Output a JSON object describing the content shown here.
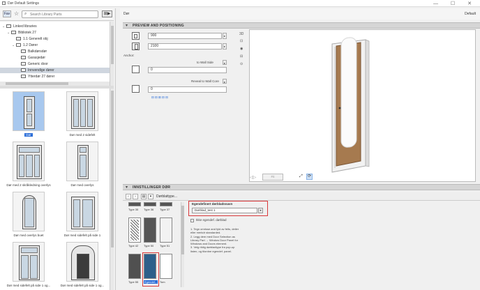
{
  "window": {
    "title": "Dør Default Settings",
    "controls": "— ☐ ✕"
  },
  "left_toolbar": {
    "favorites_btn": "Fav",
    "star": "☆",
    "search_placeholder": "Search Library Parts",
    "collapse_btn": "⊞▶"
  },
  "tree": [
    {
      "label": "Linked libraries",
      "indent": 0,
      "expander": "⌄",
      "selected": false
    },
    {
      "label": "Bibliotek 27",
      "indent": 1,
      "expander": "⌄",
      "selected": false
    },
    {
      "label": "1.1 Generelt obj",
      "indent": 2,
      "expander": "",
      "selected": false
    },
    {
      "label": "1.2 Dører",
      "indent": 2,
      "expander": "⌄",
      "selected": false
    },
    {
      "label": "Balkdørsdør",
      "indent": 3,
      "expander": "",
      "selected": false
    },
    {
      "label": "Garasjedør",
      "indent": 3,
      "expander": "",
      "selected": false
    },
    {
      "label": "Generic door",
      "indent": 3,
      "expander": "",
      "selected": false
    },
    {
      "label": "Innvendige dører",
      "indent": 3,
      "expander": "",
      "selected": true
    },
    {
      "label": "Ytterdør 27 dører",
      "indent": 3,
      "expander": "",
      "selected": false
    }
  ],
  "gallery": [
    {
      "label": "Dør",
      "selected": true
    },
    {
      "label": "Dør med 2 sidefelt",
      "selected": false
    },
    {
      "label": "Dør med 2 skråkledning overlys",
      "selected": false
    },
    {
      "label": "Dør med overlys",
      "selected": false
    },
    {
      "label": "Dør med overlys buet",
      "selected": false
    },
    {
      "label": "Dør med sidefelt på side 1",
      "selected": false
    },
    {
      "label": "Dør med sidefelt på side 1 og...",
      "selected": false
    },
    {
      "label": "Dør med sidefelt på side 1 og...",
      "selected": false
    }
  ],
  "right_header": {
    "name": "Dør",
    "default": "Default"
  },
  "preview_section": {
    "title": "PREVIEW AND POSITIONING"
  },
  "fields": {
    "width": "900",
    "height": "2100",
    "anchor_label": "Anchor:",
    "sill_label": "to Wall Side",
    "sill_value": "0",
    "reveal_label": "Reveal to Wall Core",
    "reveal_value": "0",
    "reveal_options": "⊟ ⊟ ⊞ ⊟ ⊟"
  },
  "view_tools": [
    "3D",
    "⊡",
    "◉",
    "⊟",
    "⊙"
  ],
  "preview_bottom": {
    "nav": "◁▷",
    "fit": "Fit"
  },
  "settings_section": {
    "title": "INNSTILLINGER DØR",
    "breadcrumb": "Dørblattype..."
  },
  "types": [
    {
      "label": "Type 35"
    },
    {
      "label": "Type 36"
    },
    {
      "label": "Type 37"
    },
    {
      "label": "Type 42"
    },
    {
      "label": "Type 50"
    },
    {
      "label": "Type 51"
    },
    {
      "label": "Type 55"
    },
    {
      "label": "Egendef..."
    },
    {
      "label": "Tom"
    }
  ],
  "custom_panel": {
    "heading": "Egendefinert dørbladsnavn",
    "value": "Dørblad_test 1",
    "checkbox_label": "Ikke egendef. dørblad",
    "instructions": [
      "1. Tegn omrisse and fyld av felts, deiler",
      "eller merkdr standarded.",
      "2. Legg dem med Door Selection as",
      "Library Part → Window Door Panel for",
      "Windows and Doors element.",
      "3. Velg riktig dørbladtype fra pop-up",
      "listen, og tilordne egendef. panel."
    ]
  },
  "colors": {
    "accent": "#2a6dd8",
    "highlight": "#d9383a",
    "door_wood": "#a67a4f"
  }
}
